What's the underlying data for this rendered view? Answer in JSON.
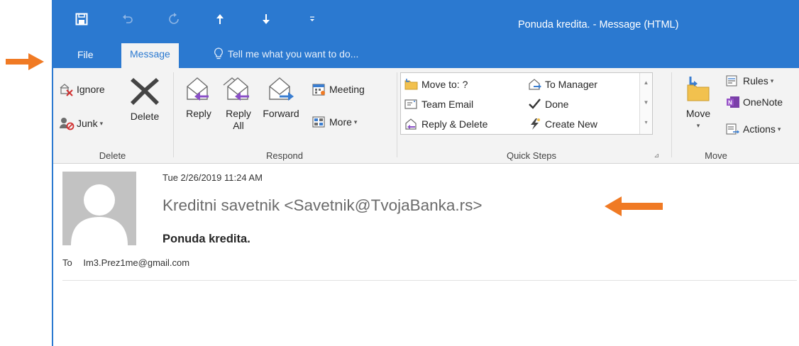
{
  "window": {
    "title": "Ponuda kredita. - Message (HTML)"
  },
  "tabs": {
    "file": "File",
    "message": "Message",
    "tell_me": "Tell me what you want to do..."
  },
  "ribbon": {
    "delete_group": {
      "label": "Delete",
      "ignore": "Ignore",
      "junk": "Junk",
      "delete": "Delete"
    },
    "respond_group": {
      "label": "Respond",
      "reply": "Reply",
      "reply_all_line1": "Reply",
      "reply_all_line2": "All",
      "forward": "Forward",
      "meeting": "Meeting",
      "more": "More"
    },
    "quick_steps": {
      "label": "Quick Steps",
      "move_to": "Move to: ?",
      "team_email": "Team Email",
      "reply_delete": "Reply & Delete",
      "to_manager": "To Manager",
      "done": "Done",
      "create_new": "Create New"
    },
    "move_group": {
      "label": "Move",
      "move": "Move",
      "rules": "Rules",
      "onenote": "OneNote",
      "actions": "Actions"
    }
  },
  "message": {
    "date": "Tue 2/26/2019 11:24 AM",
    "sender": "Kreditni savetnik <Savetnik@TvojaBanka.rs>",
    "subject": "Ponuda kredita.",
    "to_label": "To",
    "to_address": "Im3.Prez1me@gmail.com"
  },
  "colors": {
    "titlebar": "#2b79d0",
    "ribbon": "#f3f3f3",
    "arrow": "#f07a24",
    "reply_purple": "#8a4fc7",
    "forward_blue": "#3a7dd0"
  }
}
